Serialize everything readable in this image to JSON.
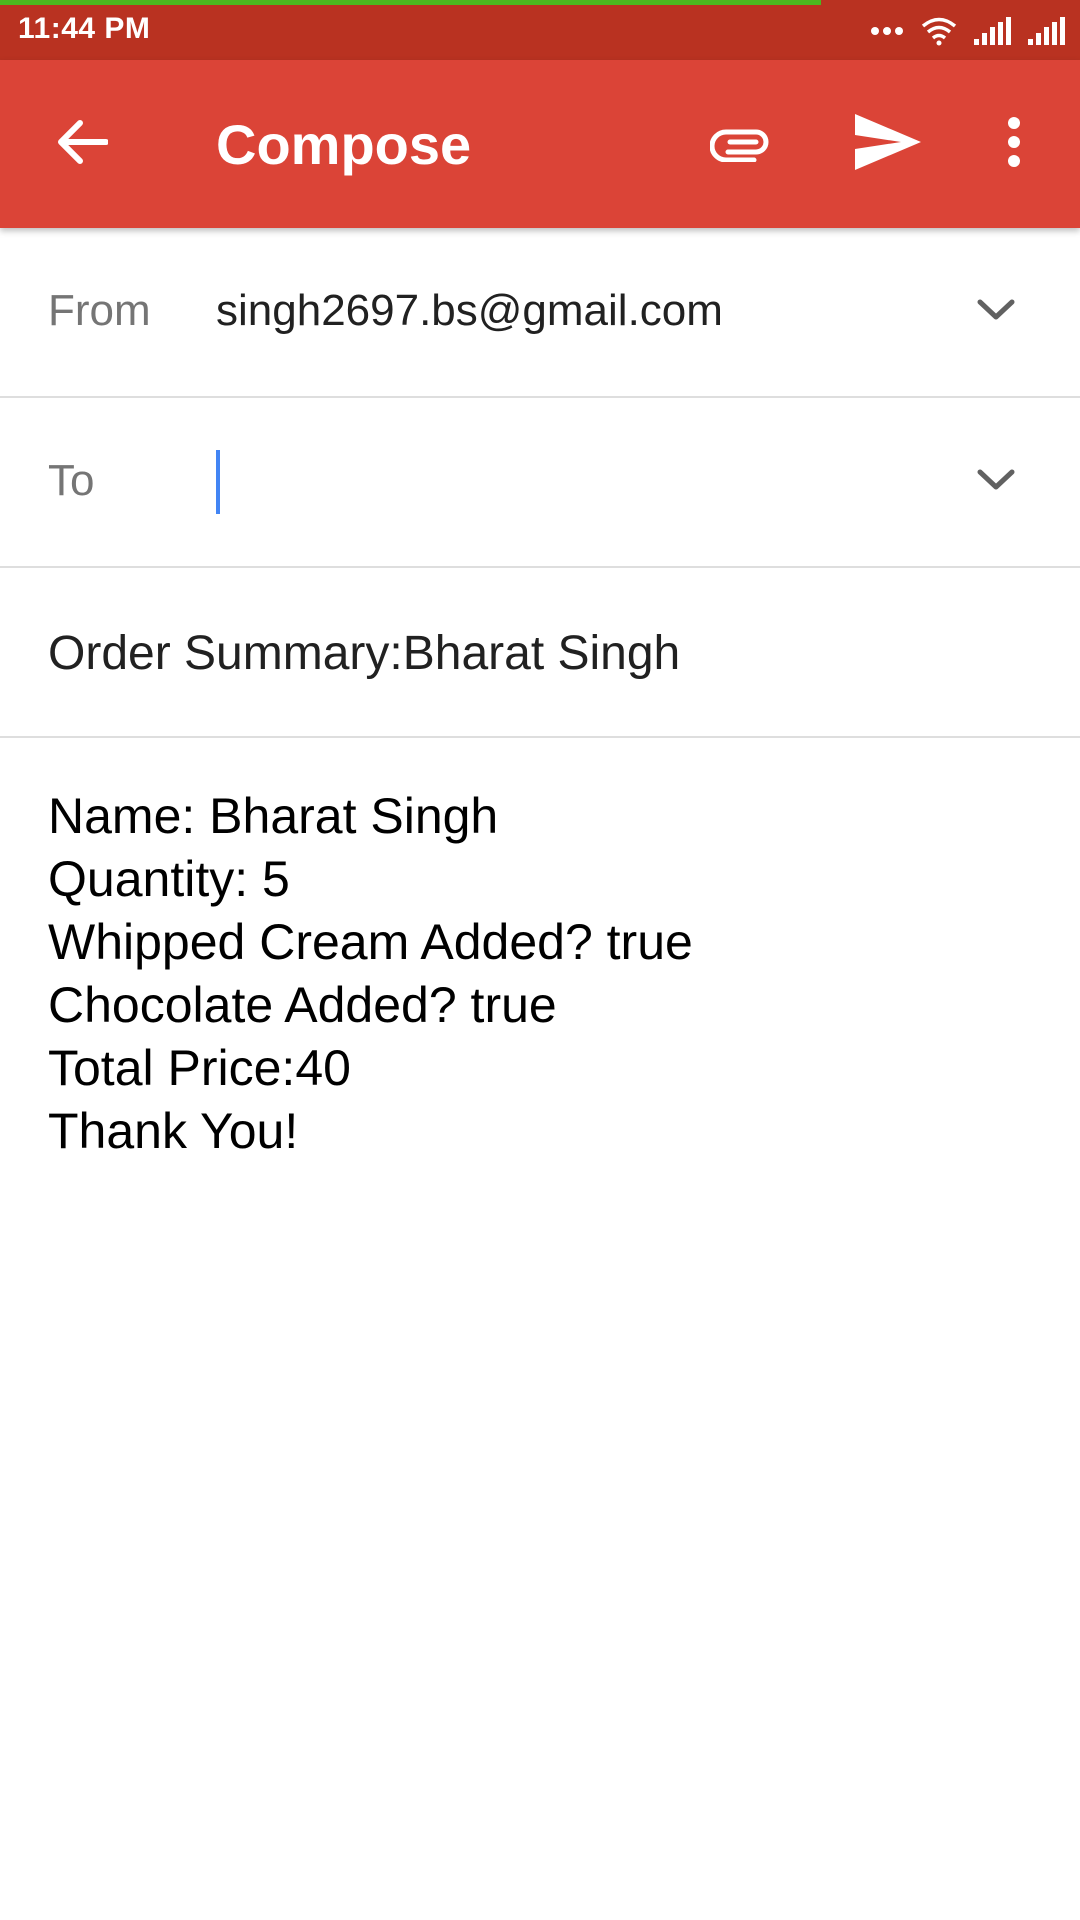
{
  "status_bar": {
    "time": "11:44 PM",
    "load_progress": 0.76,
    "icons": [
      "more-dots-icon",
      "wifi-icon",
      "signal-icon",
      "signal-icon"
    ]
  },
  "app_bar": {
    "title": "Compose",
    "icons": [
      "back-arrow-icon",
      "attach-icon",
      "send-icon",
      "overflow-menu-icon"
    ],
    "color": "#db4437"
  },
  "compose": {
    "from_label": "From",
    "from_value": "singh2697.bs@gmail.com",
    "to_label": "To",
    "to_value": "",
    "subject": "Order Summary:Bharat Singh",
    "body_lines": [
      "Name: Bharat Singh",
      "Quantity: 5",
      "Whipped Cream Added? true",
      "Chocolate Added? true",
      "Total Price:40",
      "Thank You!"
    ]
  }
}
